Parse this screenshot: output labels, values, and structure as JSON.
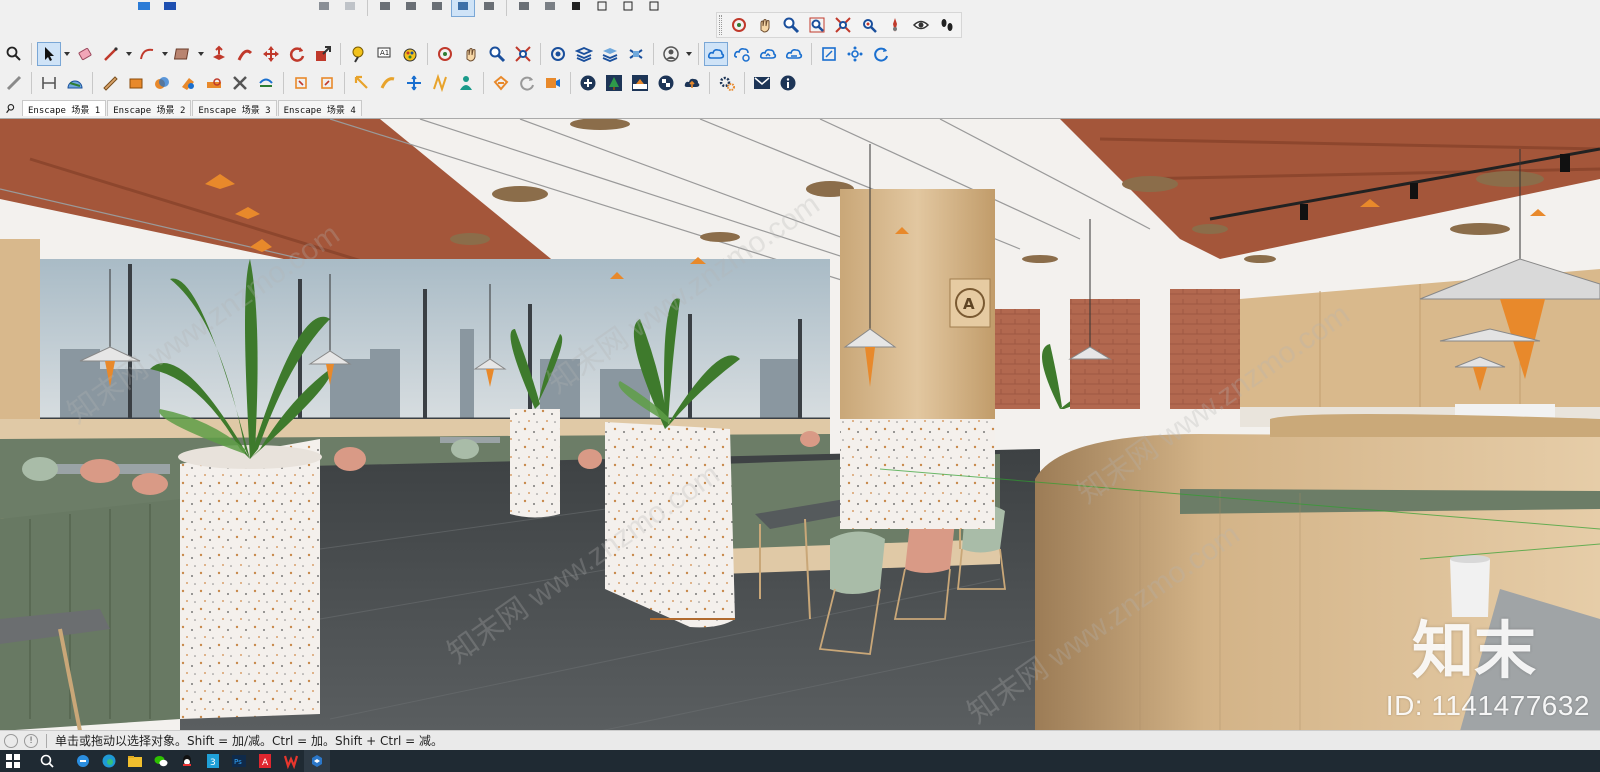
{
  "scene_tabs": [
    "Enscape 场景 1",
    "Enscape 场景 2",
    "Enscape 场景 3",
    "Enscape 场景 4"
  ],
  "active_scene_tab": 0,
  "status_text": "单击或拖动以选择对象。Shift = 加/减。Ctrl = 加。Shift + Ctrl = 减。",
  "watermark": {
    "logo_text": "知末",
    "id_text": "ID: 1141477632",
    "diagonal_text": "知末网 www.znzmo.com"
  },
  "colors": {
    "accent": "#1f6fd1",
    "wood": "#d9b98c",
    "terrazzo": "#f4f0ec",
    "floor": "#505456",
    "bench_green": "#6c7d67",
    "brick": "#b2684f",
    "ceiling_brown": "#a4563a"
  },
  "toolbar_row1_icons": [
    "orbit-icon",
    "pan-icon",
    "zoom-icon",
    "zoom-window-icon",
    "zoom-extents-icon",
    "position-camera-icon",
    "walk-icon",
    "look-around-icon",
    "footprints-icon"
  ],
  "toolbar_row2_icons": [
    "search-icon",
    "select-icon",
    "eraser-icon",
    "line-icon",
    "arc-icon",
    "rectangle-icon",
    "push-pull-icon",
    "follow-me-icon",
    "move-icon",
    "rotate-icon",
    "scale-icon",
    "tape-icon",
    "text-icon",
    "paint-icon",
    "orbit-icon",
    "pan-icon",
    "zoom-icon",
    "zoom-extents-icon",
    "component-icon",
    "layers-icon",
    "styles-icon",
    "shadows-icon",
    "account-icon",
    "cloud-icon",
    "cloud-sync-icon",
    "cloud-upload-icon",
    "cloud-download-icon",
    "frame-icon",
    "settings-icon",
    "refresh-icon"
  ],
  "toolbar_row3_icons": [
    "pencil-icon",
    "dimension-icon",
    "protractor-icon",
    "offset-icon",
    "intersect-icon",
    "outer-shell-icon",
    "union-icon",
    "subtract-icon",
    "trim-icon",
    "split-icon",
    "section-plane-icon",
    "section-cut-icon",
    "arrow-icon",
    "move-tool-icon",
    "scale-tool-icon",
    "ruler-icon",
    "person-icon",
    "enscape-start-icon",
    "enscape-sync-icon",
    "enscape-video-icon",
    "add-icon",
    "tree-icon",
    "material-icon",
    "checker-icon",
    "upload-icon",
    "settings-gear-icon",
    "mail-icon",
    "info-icon"
  ],
  "taskbar_icons": [
    "windows-icon",
    "search-icon",
    "ie-icon",
    "edge-icon",
    "folder-icon",
    "wechat-icon",
    "qq-icon",
    "sketchup-3-icon",
    "photoshop-icon",
    "acrobat-icon",
    "wps-icon",
    "sketchup-icon"
  ]
}
